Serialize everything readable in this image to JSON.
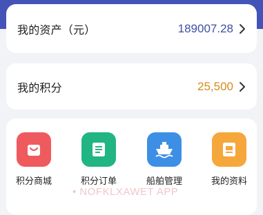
{
  "assets": {
    "label": "我的资产（元）",
    "value": "189007.28"
  },
  "points": {
    "label": "我的积分",
    "value": "25,500"
  },
  "menu": {
    "items": [
      {
        "label": "积分商城",
        "icon": "shopping-bag-icon",
        "color": "#ef5a5f"
      },
      {
        "label": "积分订单",
        "icon": "order-list-icon",
        "color": "#21b583"
      },
      {
        "label": "船舶管理",
        "icon": "ship-icon",
        "color": "#3d8fe6"
      },
      {
        "label": "我的资料",
        "icon": "profile-doc-icon",
        "color": "#f6a73b"
      }
    ]
  },
  "watermark": "• NOFKLXAWET APP",
  "colors": {
    "header": "#4453b8",
    "value_blue": "#3d4fa5",
    "value_orange": "#d68a1d"
  }
}
